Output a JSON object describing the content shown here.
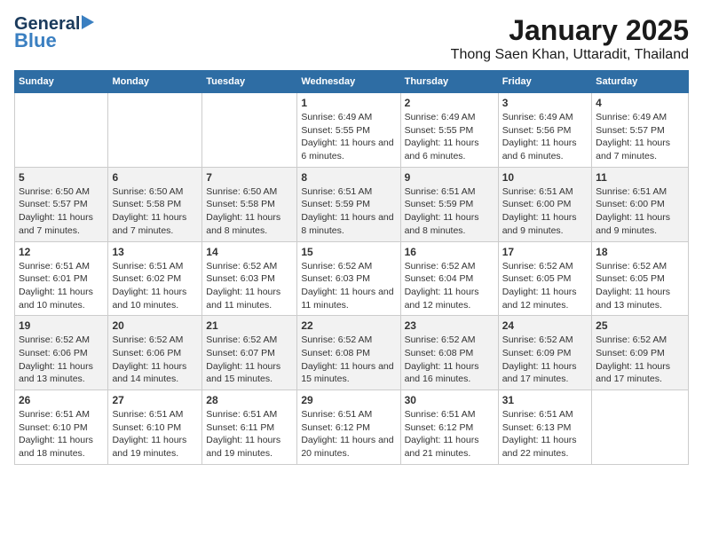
{
  "logo": {
    "line1": "General",
    "line2": "Blue"
  },
  "title": "January 2025",
  "subtitle": "Thong Saen Khan, Uttaradit, Thailand",
  "weekdays": [
    "Sunday",
    "Monday",
    "Tuesday",
    "Wednesday",
    "Thursday",
    "Friday",
    "Saturday"
  ],
  "weeks": [
    [
      {
        "day": "",
        "info": ""
      },
      {
        "day": "",
        "info": ""
      },
      {
        "day": "",
        "info": ""
      },
      {
        "day": "1",
        "info": "Sunrise: 6:49 AM\nSunset: 5:55 PM\nDaylight: 11 hours and 6 minutes."
      },
      {
        "day": "2",
        "info": "Sunrise: 6:49 AM\nSunset: 5:55 PM\nDaylight: 11 hours and 6 minutes."
      },
      {
        "day": "3",
        "info": "Sunrise: 6:49 AM\nSunset: 5:56 PM\nDaylight: 11 hours and 6 minutes."
      },
      {
        "day": "4",
        "info": "Sunrise: 6:49 AM\nSunset: 5:57 PM\nDaylight: 11 hours and 7 minutes."
      }
    ],
    [
      {
        "day": "5",
        "info": "Sunrise: 6:50 AM\nSunset: 5:57 PM\nDaylight: 11 hours and 7 minutes."
      },
      {
        "day": "6",
        "info": "Sunrise: 6:50 AM\nSunset: 5:58 PM\nDaylight: 11 hours and 7 minutes."
      },
      {
        "day": "7",
        "info": "Sunrise: 6:50 AM\nSunset: 5:58 PM\nDaylight: 11 hours and 8 minutes."
      },
      {
        "day": "8",
        "info": "Sunrise: 6:51 AM\nSunset: 5:59 PM\nDaylight: 11 hours and 8 minutes."
      },
      {
        "day": "9",
        "info": "Sunrise: 6:51 AM\nSunset: 5:59 PM\nDaylight: 11 hours and 8 minutes."
      },
      {
        "day": "10",
        "info": "Sunrise: 6:51 AM\nSunset: 6:00 PM\nDaylight: 11 hours and 9 minutes."
      },
      {
        "day": "11",
        "info": "Sunrise: 6:51 AM\nSunset: 6:00 PM\nDaylight: 11 hours and 9 minutes."
      }
    ],
    [
      {
        "day": "12",
        "info": "Sunrise: 6:51 AM\nSunset: 6:01 PM\nDaylight: 11 hours and 10 minutes."
      },
      {
        "day": "13",
        "info": "Sunrise: 6:51 AM\nSunset: 6:02 PM\nDaylight: 11 hours and 10 minutes."
      },
      {
        "day": "14",
        "info": "Sunrise: 6:52 AM\nSunset: 6:03 PM\nDaylight: 11 hours and 11 minutes."
      },
      {
        "day": "15",
        "info": "Sunrise: 6:52 AM\nSunset: 6:03 PM\nDaylight: 11 hours and 11 minutes."
      },
      {
        "day": "16",
        "info": "Sunrise: 6:52 AM\nSunset: 6:04 PM\nDaylight: 11 hours and 12 minutes."
      },
      {
        "day": "17",
        "info": "Sunrise: 6:52 AM\nSunset: 6:05 PM\nDaylight: 11 hours and 12 minutes."
      },
      {
        "day": "18",
        "info": "Sunrise: 6:52 AM\nSunset: 6:05 PM\nDaylight: 11 hours and 13 minutes."
      }
    ],
    [
      {
        "day": "19",
        "info": "Sunrise: 6:52 AM\nSunset: 6:06 PM\nDaylight: 11 hours and 13 minutes."
      },
      {
        "day": "20",
        "info": "Sunrise: 6:52 AM\nSunset: 6:06 PM\nDaylight: 11 hours and 14 minutes."
      },
      {
        "day": "21",
        "info": "Sunrise: 6:52 AM\nSunset: 6:07 PM\nDaylight: 11 hours and 15 minutes."
      },
      {
        "day": "22",
        "info": "Sunrise: 6:52 AM\nSunset: 6:08 PM\nDaylight: 11 hours and 15 minutes."
      },
      {
        "day": "23",
        "info": "Sunrise: 6:52 AM\nSunset: 6:08 PM\nDaylight: 11 hours and 16 minutes."
      },
      {
        "day": "24",
        "info": "Sunrise: 6:52 AM\nSunset: 6:09 PM\nDaylight: 11 hours and 17 minutes."
      },
      {
        "day": "25",
        "info": "Sunrise: 6:52 AM\nSunset: 6:09 PM\nDaylight: 11 hours and 17 minutes."
      }
    ],
    [
      {
        "day": "26",
        "info": "Sunrise: 6:51 AM\nSunset: 6:10 PM\nDaylight: 11 hours and 18 minutes."
      },
      {
        "day": "27",
        "info": "Sunrise: 6:51 AM\nSunset: 6:10 PM\nDaylight: 11 hours and 19 minutes."
      },
      {
        "day": "28",
        "info": "Sunrise: 6:51 AM\nSunset: 6:11 PM\nDaylight: 11 hours and 19 minutes."
      },
      {
        "day": "29",
        "info": "Sunrise: 6:51 AM\nSunset: 6:12 PM\nDaylight: 11 hours and 20 minutes."
      },
      {
        "day": "30",
        "info": "Sunrise: 6:51 AM\nSunset: 6:12 PM\nDaylight: 11 hours and 21 minutes."
      },
      {
        "day": "31",
        "info": "Sunrise: 6:51 AM\nSunset: 6:13 PM\nDaylight: 11 hours and 22 minutes."
      },
      {
        "day": "",
        "info": ""
      }
    ]
  ]
}
